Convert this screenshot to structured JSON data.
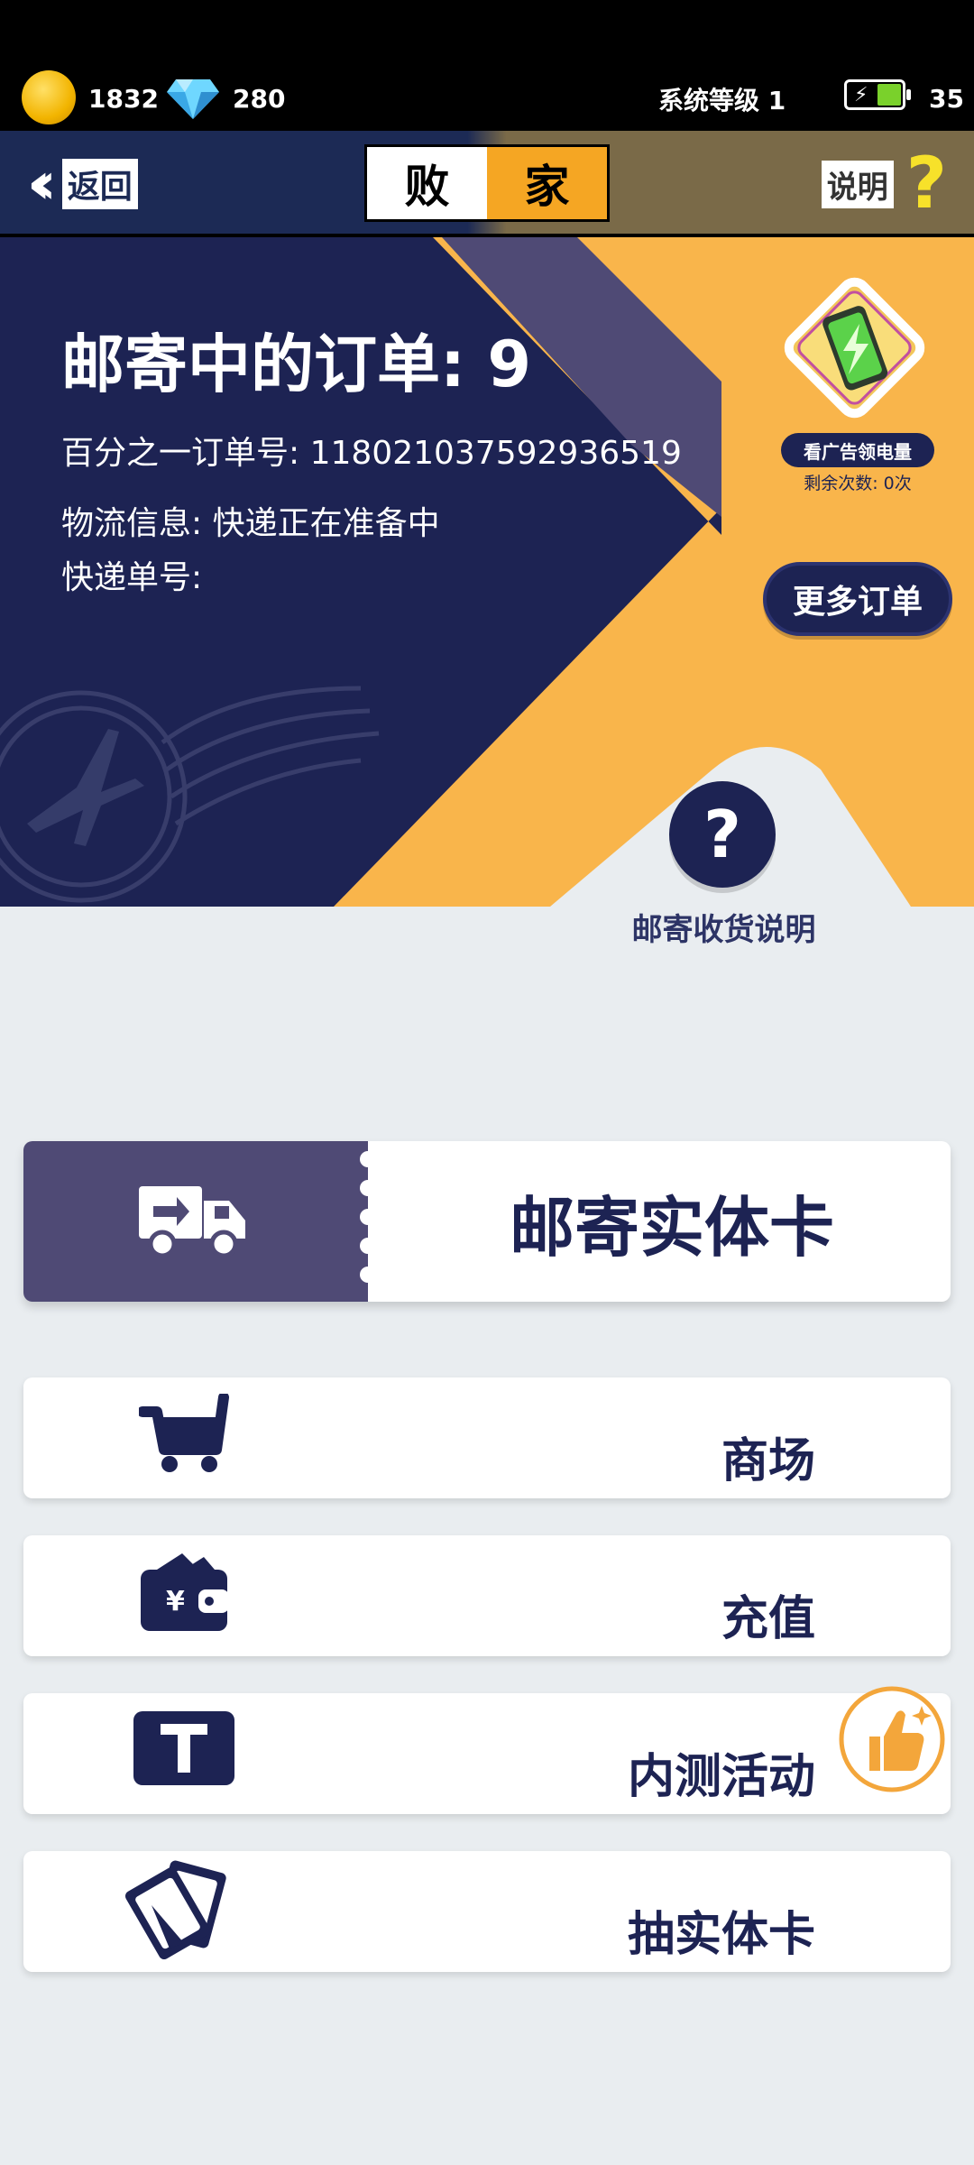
{
  "status": {
    "coins": "1832",
    "gems": "280",
    "system_level": "系统等级 1",
    "energy": "35"
  },
  "header": {
    "back_label": "返回",
    "tab_left": "败",
    "tab_right": "家",
    "help_label": "说明"
  },
  "banner": {
    "title": "邮寄中的订单: 9",
    "order_no": "百分之一订单号: 118021037592936519",
    "logistics": "物流信息: 快递正在准备中",
    "tracking": "快递单号:",
    "ad_label": "看广告领电量",
    "ad_remaining": "剩余次数: 0次",
    "more_orders": "更多订单",
    "help_caption": "邮寄收货说明"
  },
  "mail_card": {
    "label": "邮寄实体卡"
  },
  "menu": [
    {
      "label": "商场",
      "icon": "cart-icon"
    },
    {
      "label": "充值",
      "icon": "wallet-icon"
    },
    {
      "label": "内测活动",
      "icon": "t-icon"
    },
    {
      "label": "抽实体卡",
      "icon": "cards-icon"
    }
  ],
  "colors": {
    "navy": "#1d2353",
    "orange": "#f9b54b",
    "purple": "#4f4a75",
    "background": "#e9edf0"
  }
}
